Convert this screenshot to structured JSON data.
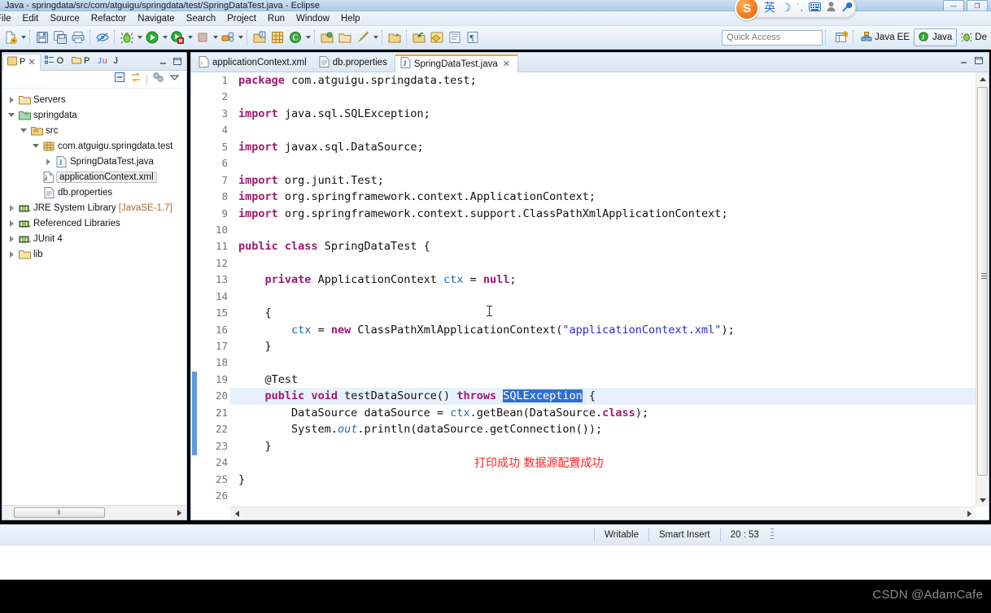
{
  "window": {
    "title": "Java - springdata/src/com/atguigu/springdata/test/SpringDataTest.java - Eclipse",
    "minimize_label": "—",
    "restore_label": "❐"
  },
  "menubar": {
    "items": [
      {
        "label": "File"
      },
      {
        "label": "Edit"
      },
      {
        "label": "Source"
      },
      {
        "label": "Refactor"
      },
      {
        "label": "Navigate"
      },
      {
        "label": "Search"
      },
      {
        "label": "Project"
      },
      {
        "label": "Run"
      },
      {
        "label": "Window"
      },
      {
        "label": "Help"
      }
    ]
  },
  "ime": {
    "mode_label": "英",
    "moon_icon": "moon-icon",
    "punct_icon": "punctuation-icon",
    "keyboard_icon": "keyboard-icon",
    "user_icon": "user-icon",
    "tools_icon": "wrench-icon"
  },
  "toolbar": {
    "icons": [
      "new-icon",
      "save-icon",
      "save-all-icon",
      "print-icon",
      "toggle-mark-occurrences-icon",
      "debug-icon",
      "run-icon",
      "coverage-icon",
      "stop-icon",
      "external-tools-icon",
      "new-java-project-icon",
      "new-package-icon",
      "new-class-icon",
      "open-type-icon",
      "open-task-icon",
      "search-icon",
      "last-edit-location-icon",
      "back-icon",
      "forward-icon",
      "pin-editor-icon",
      "toggle-breadcrumb-icon",
      "show-whitespace-icon"
    ],
    "quick_access_placeholder": "Quick Access"
  },
  "perspectives": {
    "open_perspective_label": "",
    "items": [
      {
        "label": "Java EE",
        "active": false
      },
      {
        "label": "Java",
        "active": true
      },
      {
        "label": "De",
        "active": false
      }
    ]
  },
  "explorer": {
    "tabs": [
      {
        "label": "P",
        "icon": "package-explorer-icon",
        "active": true,
        "close": "✕"
      },
      {
        "label": "O",
        "icon": "outline-icon",
        "active": false
      },
      {
        "label": "P",
        "icon": "project-explorer-icon",
        "active": false
      },
      {
        "label": "J",
        "icon": "junit-icon",
        "active": false
      }
    ],
    "view_buttons": [
      "minimize-icon",
      "maximize-icon"
    ],
    "tool_buttons": [
      "collapse-all-icon",
      "link-with-editor-icon",
      "filter-icon",
      "view-menu-icon"
    ],
    "tree": [
      {
        "label": "Servers",
        "icon": "folder-icon",
        "indent": 0,
        "twisty": "collapsed",
        "selected": false
      },
      {
        "label": "springdata",
        "icon": "java-project-icon",
        "indent": 0,
        "twisty": "expanded",
        "selected": false
      },
      {
        "label": "src",
        "icon": "source-folder-icon",
        "indent": 1,
        "twisty": "expanded",
        "selected": false
      },
      {
        "label": "com.atguigu.springdata.test",
        "icon": "package-icon",
        "indent": 2,
        "twisty": "expanded",
        "selected": false
      },
      {
        "label": "SpringDataTest.java",
        "icon": "java-file-icon",
        "indent": 3,
        "twisty": "collapsed",
        "selected": false
      },
      {
        "label": "applicationContext.xml",
        "icon": "spring-xml-icon",
        "indent": 2,
        "twisty": "none",
        "selected": true
      },
      {
        "label": "db.properties",
        "icon": "properties-file-icon",
        "indent": 2,
        "twisty": "none",
        "selected": false
      },
      {
        "label": "JRE System Library",
        "suffix": "[JavaSE-1.7]",
        "icon": "library-icon",
        "indent": 0,
        "twisty": "collapsed",
        "selected": false
      },
      {
        "label": "Referenced Libraries",
        "icon": "library-icon",
        "indent": 0,
        "twisty": "collapsed",
        "selected": false
      },
      {
        "label": "JUnit 4",
        "icon": "library-icon",
        "indent": 0,
        "twisty": "collapsed",
        "selected": false
      },
      {
        "label": "lib",
        "icon": "folder-icon",
        "indent": 0,
        "twisty": "collapsed",
        "selected": false
      }
    ],
    "hscroll_grip": "⦀"
  },
  "editor": {
    "tabs": [
      {
        "label": "applicationContext.xml",
        "icon": "xml-file-icon",
        "active": false
      },
      {
        "label": "db.properties",
        "icon": "properties-file-icon",
        "active": false
      },
      {
        "label": "SpringDataTest.java",
        "icon": "java-file-icon",
        "active": true,
        "close": "✕"
      }
    ],
    "annotation_note": "打印成功 数据源配置成功",
    "current_line": 20,
    "selected_token": "SQLException",
    "lines": [
      {
        "n": 1,
        "fold": false,
        "text": "package com.atguigu.springdata.test;"
      },
      {
        "n": 2,
        "fold": false,
        "text": ""
      },
      {
        "n": 3,
        "fold": true,
        "text": "import java.sql.SQLException;"
      },
      {
        "n": 4,
        "fold": false,
        "text": ""
      },
      {
        "n": 5,
        "fold": false,
        "text": "import javax.sql.DataSource;"
      },
      {
        "n": 6,
        "fold": false,
        "text": ""
      },
      {
        "n": 7,
        "fold": false,
        "text": "import org.junit.Test;"
      },
      {
        "n": 8,
        "fold": false,
        "text": "import org.springframework.context.ApplicationContext;"
      },
      {
        "n": 9,
        "fold": false,
        "text": "import org.springframework.context.support.ClassPathXmlApplicationContext;"
      },
      {
        "n": 10,
        "fold": false,
        "text": ""
      },
      {
        "n": 11,
        "fold": false,
        "text": "public class SpringDataTest {"
      },
      {
        "n": 12,
        "fold": false,
        "text": ""
      },
      {
        "n": 13,
        "fold": false,
        "text": "    private ApplicationContext ctx = null;"
      },
      {
        "n": 14,
        "fold": false,
        "text": ""
      },
      {
        "n": 15,
        "fold": true,
        "text": "    {"
      },
      {
        "n": 16,
        "fold": false,
        "text": "        ctx = new ClassPathXmlApplicationContext(\"applicationContext.xml\");"
      },
      {
        "n": 17,
        "fold": false,
        "text": "    }"
      },
      {
        "n": 18,
        "fold": false,
        "text": ""
      },
      {
        "n": 19,
        "fold": true,
        "text": "    @Test"
      },
      {
        "n": 20,
        "fold": false,
        "text": "    public void testDataSource() throws SQLException {"
      },
      {
        "n": 21,
        "fold": false,
        "text": "        DataSource dataSource = ctx.getBean(DataSource.class);"
      },
      {
        "n": 22,
        "fold": false,
        "text": "        System.out.println(dataSource.getConnection());"
      },
      {
        "n": 23,
        "fold": false,
        "text": "    }"
      },
      {
        "n": 24,
        "fold": false,
        "text": ""
      },
      {
        "n": 25,
        "fold": false,
        "text": "}"
      },
      {
        "n": 26,
        "fold": false,
        "text": ""
      }
    ]
  },
  "statusbar": {
    "writable": "Writable",
    "insert_mode": "Smart Insert",
    "position": "20 : 53"
  },
  "watermark": {
    "text": "CSDN @AdamCafe"
  },
  "colors": {
    "keyword": "#9e1a6e",
    "string": "#2a2ad4",
    "field": "#1b6ab0",
    "selection": "#2f6fd0",
    "current_line": "#e8f1fb",
    "annotation_red": "#ff2020",
    "change_bar": "#5d9bdb"
  }
}
